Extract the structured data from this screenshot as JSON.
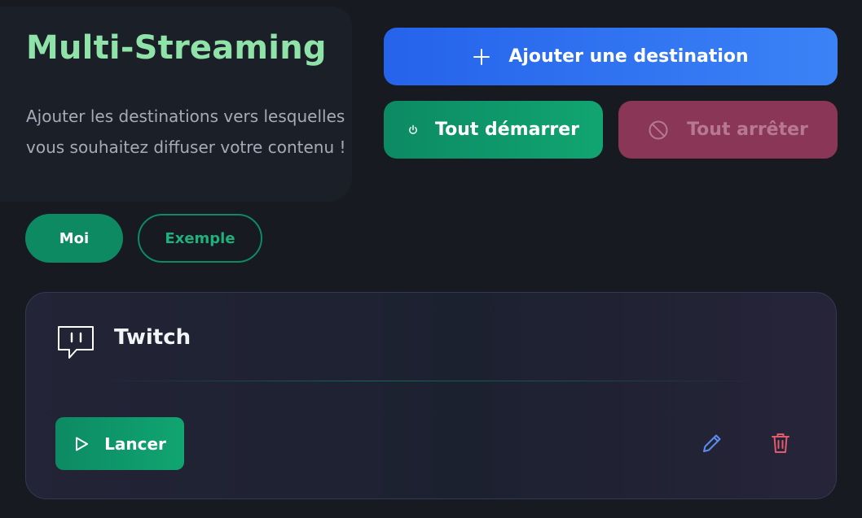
{
  "header": {
    "title": "Multi-Streaming",
    "subtitle": "Ajouter les destinations vers lesquelles vous souhaitez diffuser votre contenu !"
  },
  "profiles": {
    "items": [
      {
        "label": "Moi",
        "active": true
      },
      {
        "label": "Exemple",
        "active": false
      }
    ]
  },
  "actions": {
    "add_label": "Ajouter une destination",
    "start_all_label": "Tout démarrer",
    "stop_all_label": "Tout arrêter"
  },
  "destinations": [
    {
      "name": "Twitch",
      "icon": "twitch-icon",
      "launch_label": "Lancer",
      "edit_icon": "pencil-icon",
      "delete_icon": "trash-icon"
    }
  ],
  "colors": {
    "background": "#171b21",
    "title": "#8fe3a8",
    "accent_green": "#10a571",
    "accent_blue": "#3b82f6",
    "danger": "#8a3656",
    "edit_icon": "#5b8def",
    "delete_icon": "#e25a6b"
  }
}
